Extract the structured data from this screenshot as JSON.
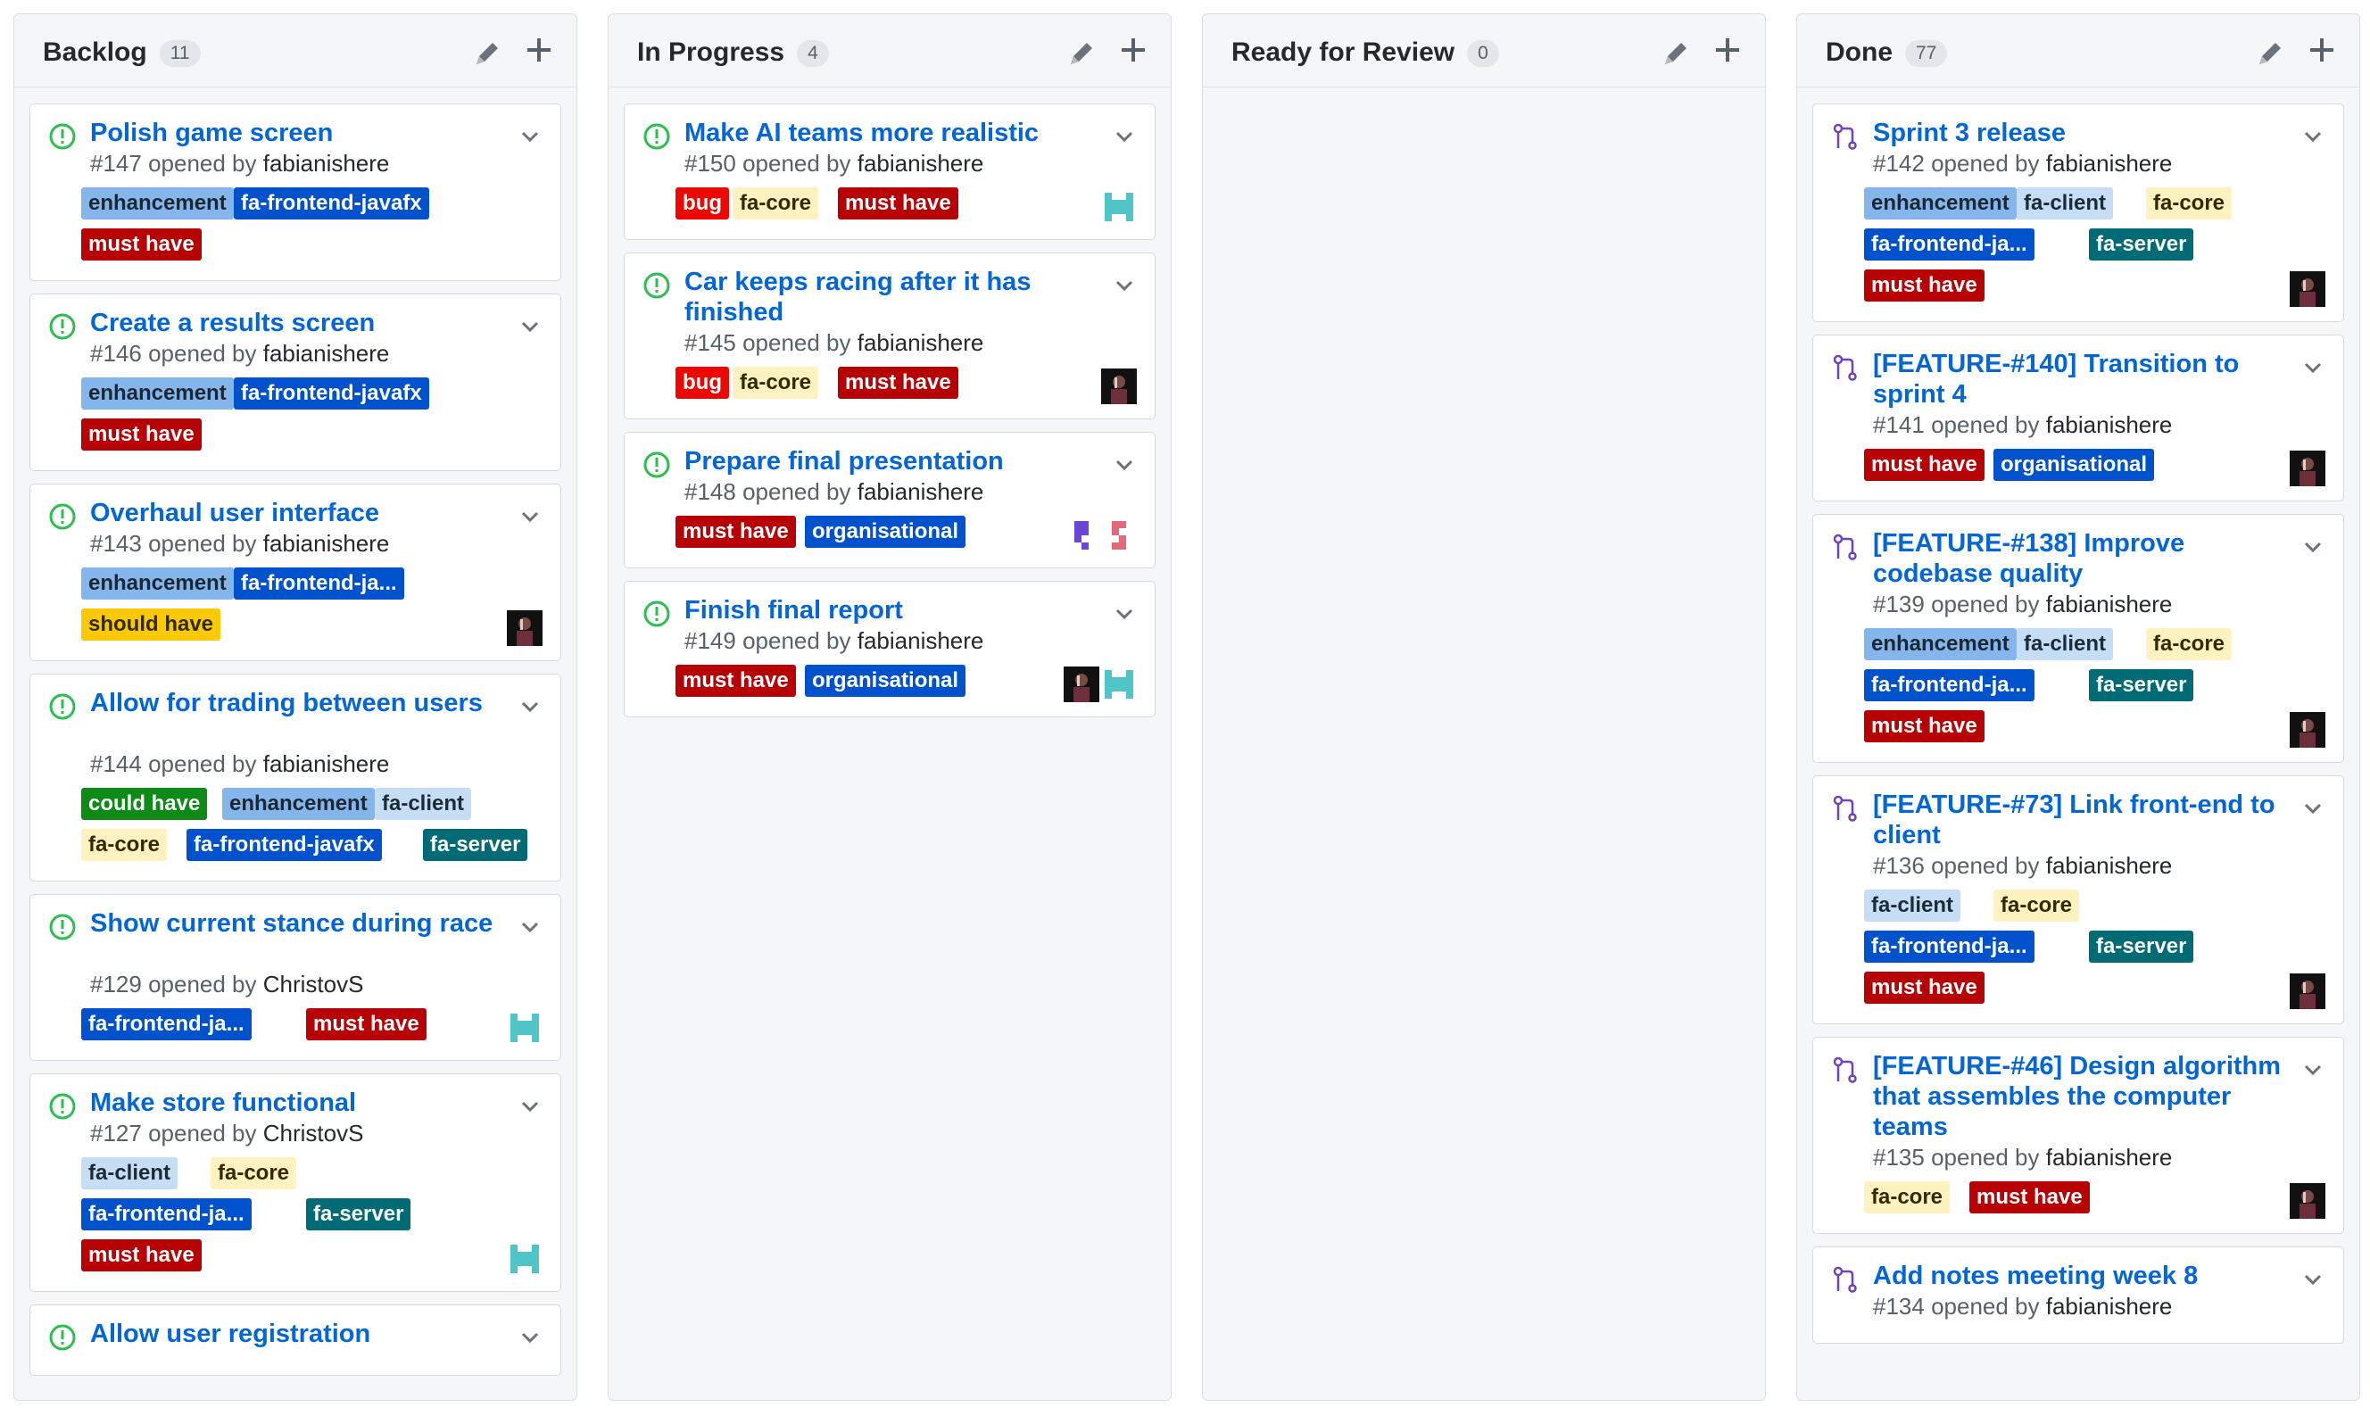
{
  "colors": {
    "link": "#0366d6",
    "open_icon": "#2cbe4e",
    "merged_icon": "#6f42c1"
  },
  "label_styles": {
    "enhancement": {
      "bg": "#84b6eb",
      "fg": "#1c2733"
    },
    "fa-frontend-javafx": {
      "bg": "#0052cc",
      "fg": "#ffffff"
    },
    "fa-frontend-ja...": {
      "bg": "#0052cc",
      "fg": "#ffffff"
    },
    "must have": {
      "bg": "#b60205",
      "fg": "#ffffff"
    },
    "should have": {
      "bg": "#fbca04",
      "fg": "#332900"
    },
    "could have": {
      "bg": "#0e8a16",
      "fg": "#ffffff"
    },
    "fa-client": {
      "bg": "#c5def5",
      "fg": "#1d2b38"
    },
    "fa-core": {
      "bg": "#fef2c0",
      "fg": "#332900"
    },
    "fa-server": {
      "bg": "#006b75",
      "fg": "#ffffff"
    },
    "bug": {
      "bg": "#ee0701",
      "fg": "#ffffff"
    },
    "organisational": {
      "bg": "#0052cc",
      "fg": "#ffffff"
    }
  },
  "columns": [
    {
      "name": "Backlog",
      "count": "11",
      "cards": [
        {
          "title": "Polish game screen",
          "number": "#147",
          "author": "fabianishere",
          "icon": "open-issue-icon",
          "labels": [
            [
              "enhancement",
              "fa-frontend-javafx"
            ],
            [
              "must have"
            ]
          ],
          "avatars": []
        },
        {
          "title": "Create a results screen",
          "number": "#146",
          "author": "fabianishere",
          "icon": "open-issue-icon",
          "labels": [
            [
              "enhancement",
              "fa-frontend-javafx"
            ],
            [
              "must have"
            ]
          ],
          "avatars": []
        },
        {
          "title": "Overhaul user interface",
          "number": "#143",
          "author": "fabianishere",
          "icon": "open-issue-icon",
          "labels": [
            [
              "enhancement",
              "fa-frontend-ja..."
            ],
            [
              "should have"
            ]
          ],
          "avatars": [
            "photo-avatar"
          ]
        },
        {
          "title": "Allow for trading between users",
          "number": "#144",
          "author": "fabianishere",
          "icon": "open-issue-icon",
          "labels": [
            [
              "could have",
              "enhancement",
              "fa-client"
            ],
            [
              "fa-core",
              "fa-frontend-javafx",
              "fa-server"
            ]
          ],
          "avatars": []
        },
        {
          "title": "Show current stance during race",
          "number": "#129",
          "author": "ChristovS",
          "icon": "open-issue-icon",
          "labels": [
            [
              "fa-frontend-ja...",
              "must have"
            ]
          ],
          "avatars": [
            "teal-identicon-avatar"
          ]
        },
        {
          "title": "Make store functional",
          "number": "#127",
          "author": "ChristovS",
          "icon": "open-issue-icon",
          "labels": [
            [
              "fa-client",
              "fa-core"
            ],
            [
              "fa-frontend-ja...",
              "fa-server"
            ],
            [
              "must have"
            ]
          ],
          "avatars": [
            "teal-identicon-avatar"
          ]
        },
        {
          "title": "Allow user registration",
          "number": "",
          "author": "",
          "icon": "open-issue-icon",
          "labels": [],
          "avatars": []
        }
      ]
    },
    {
      "name": "In Progress",
      "count": "4",
      "cards": [
        {
          "title": "Make AI teams more realistic",
          "number": "#150",
          "author": "fabianishere",
          "icon": "open-issue-icon",
          "labels": [
            [
              "bug",
              "fa-core",
              "must have"
            ]
          ],
          "avatars": [
            "teal-identicon-avatar"
          ]
        },
        {
          "title": "Car keeps racing after it has finished",
          "number": "#145",
          "author": "fabianishere",
          "icon": "open-issue-icon",
          "labels": [
            [
              "bug",
              "fa-core",
              "must have"
            ]
          ],
          "avatars": [
            "photo-avatar"
          ]
        },
        {
          "title": "Prepare final presentation",
          "number": "#148",
          "author": "fabianishere",
          "icon": "open-issue-icon",
          "labels": [
            [
              "must have",
              "organisational"
            ]
          ],
          "avatars": [
            "purple-identicon-avatar",
            "pink-identicon-avatar"
          ]
        },
        {
          "title": "Finish final report",
          "number": "#149",
          "author": "fabianishere",
          "icon": "open-issue-icon",
          "labels": [
            [
              "must have",
              "organisational"
            ]
          ],
          "avatars": [
            "photo-avatar",
            "teal-identicon-avatar"
          ]
        }
      ]
    },
    {
      "name": "Ready for Review",
      "count": "0",
      "cards": []
    },
    {
      "name": "Done",
      "count": "77",
      "cards": [
        {
          "title": "Sprint 3 release",
          "number": "#142",
          "author": "fabianishere",
          "icon": "merged-pr-icon",
          "labels": [
            [
              "enhancement",
              "fa-client",
              "fa-core"
            ],
            [
              "fa-frontend-ja...",
              "fa-server"
            ],
            [
              "must have"
            ]
          ],
          "avatars": [
            "photo-avatar"
          ]
        },
        {
          "title": "[FEATURE-#140] Transition to sprint 4",
          "number": "#141",
          "author": "fabianishere",
          "icon": "merged-pr-icon",
          "labels": [
            [
              "must have",
              "organisational"
            ]
          ],
          "avatars": [
            "photo-avatar"
          ]
        },
        {
          "title": "[FEATURE-#138] Improve codebase quality",
          "number": "#139",
          "author": "fabianishere",
          "icon": "merged-pr-icon",
          "labels": [
            [
              "enhancement",
              "fa-client",
              "fa-core"
            ],
            [
              "fa-frontend-ja...",
              "fa-server"
            ],
            [
              "must have"
            ]
          ],
          "avatars": [
            "photo-avatar"
          ]
        },
        {
          "title": "[FEATURE-#73] Link front-end to client",
          "number": "#136",
          "author": "fabianishere",
          "icon": "merged-pr-icon",
          "labels": [
            [
              "fa-client",
              "fa-core"
            ],
            [
              "fa-frontend-ja...",
              "fa-server"
            ],
            [
              "must have"
            ]
          ],
          "avatars": [
            "photo-avatar"
          ]
        },
        {
          "title": "[FEATURE-#46] Design algorithm that assembles the computer teams",
          "number": "#135",
          "author": "fabianishere",
          "icon": "merged-pr-icon",
          "labels": [
            [
              "fa-core",
              "must have"
            ]
          ],
          "avatars": [
            "photo-avatar"
          ]
        },
        {
          "title": "Add notes meeting week 8",
          "number": "#134",
          "author": "fabianishere",
          "icon": "merged-pr-icon",
          "labels": [],
          "avatars": []
        }
      ]
    }
  ],
  "ui": {
    "opened_by": " opened by ",
    "edit": "edit-icon",
    "add": "plus-icon",
    "menu": "chevron-down-icon"
  }
}
